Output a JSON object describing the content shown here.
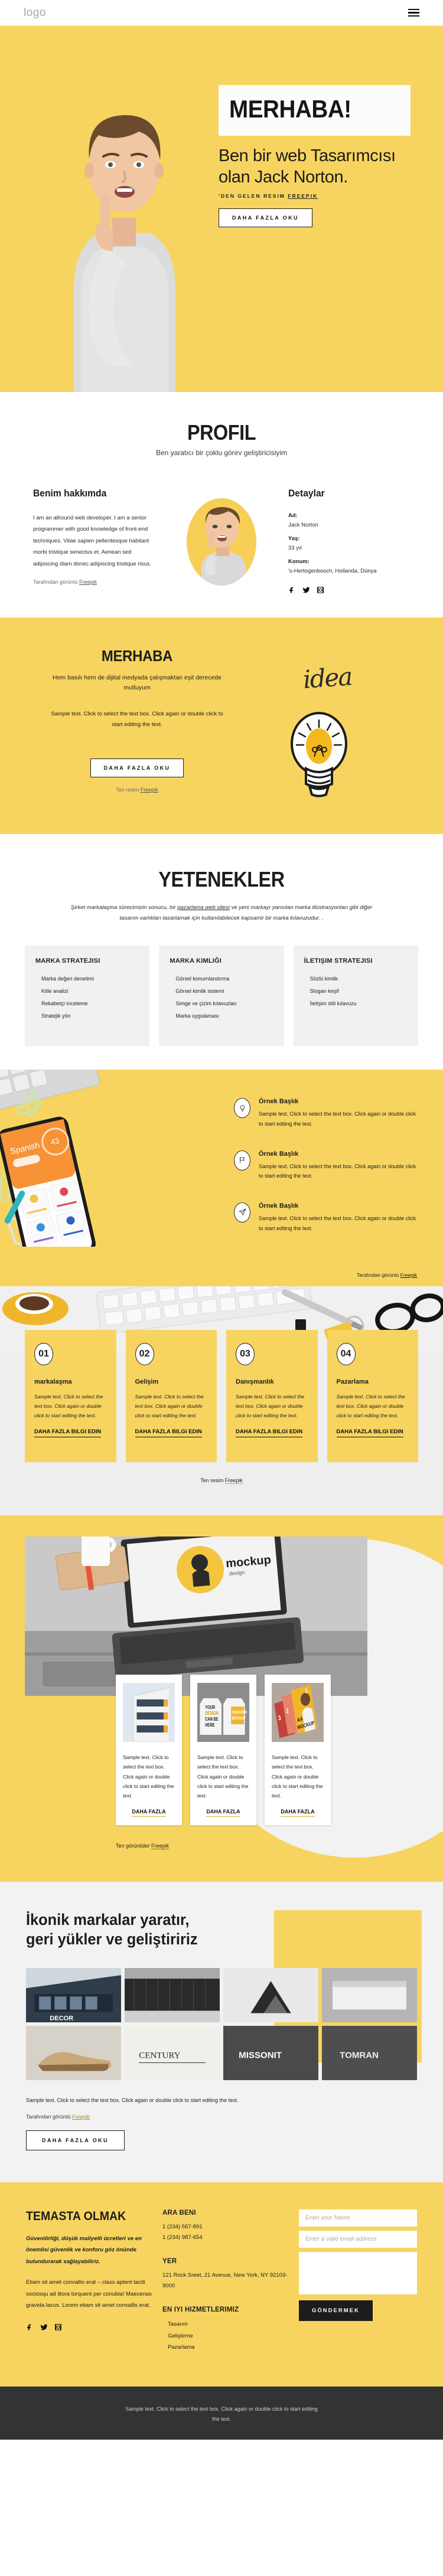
{
  "header": {
    "logo": "logo",
    "menu_label": "menu"
  },
  "hero": {
    "badge": "MERHABA!",
    "headline": "Ben bir web Tasarımcısı olan Jack Norton.",
    "credit": "'DEN GELEN RESIM ",
    "credit_link": "FREEPIK",
    "cta": "DAHA FAZLA OKU"
  },
  "profil": {
    "title": "PROFIL",
    "subtitle": "Ben yaratıcı bir çoklu görev geliştiricisiyim",
    "about_head": "Benim hakkımda",
    "about_body": "I am an allround web developer. I am a senior programmer with good knowledge of front-end techniques. Vitae sapien pellentesque habitant morbi tristique senectus et. Aenean sed adipiscing diam donec adipiscing tristique risus.",
    "about_credit": "Tarafından görüntü ",
    "about_credit_link": "Freepik",
    "details_head": "Detaylar",
    "details": [
      {
        "label": "Ad:",
        "value": "Jack Norton"
      },
      {
        "label": "Yaş:",
        "value": "33 yıl"
      },
      {
        "label": "Konum:",
        "value": "'s-Hertogenbosch, Hollanda, Dünya"
      }
    ],
    "socials": [
      "facebook-icon",
      "twitter-icon",
      "instagram-icon"
    ]
  },
  "merhaba": {
    "title": "MERHABA",
    "tagline": "Hem basılı hem de dijital medyada çalışmaktan eşit derecede mutluyum",
    "body": "Sample text. Click to select the text box. Click again or double click to start editing the text.",
    "cta": "DAHA FAZLA OKU",
    "idea_word": "idea",
    "credit": "Ten resim ",
    "credit_link": "Freepik"
  },
  "yetenekler": {
    "title": "YETENEKLER",
    "desc_1": "Şirket markalaşma sürecimizin sonucu, bir ",
    "desc_link": "pazarlama web sitesi",
    "desc_2": " ve yeni markayı yansıtan marka illüstrasyonları gibi diğer tasarım varlıkları tasarlamak için kullanılabilecek kapsamlı bir marka kılavuzudur. .",
    "cards": [
      {
        "title": "MARKA STRATEJISI",
        "items": [
          "Marka değeri denetimi",
          "Kitle analizi",
          "Rekabetçi inceleme",
          "Stratejik yön"
        ]
      },
      {
        "title": "MARKA KIMLIĞI",
        "items": [
          "Görsel konumlandırma",
          "Görsel kimlik sistemi",
          "Simge ve çizim kılavuzları",
          "Marka uygulaması"
        ]
      },
      {
        "title": "İLETIŞIM STRATEJISI",
        "items": [
          "Sözlü kimlik",
          "Slogan keşif",
          "İletişim stili kılavuzu"
        ]
      }
    ]
  },
  "features": {
    "items": [
      {
        "icon": "lightbulb-icon",
        "title": "Örnek Başlık",
        "body": "Sample text. Click to select the text box. Click again or double click to start editing the text."
      },
      {
        "icon": "flag-icon",
        "title": "Örnek Başlık",
        "body": "Sample text. Click to select the text box. Click again or double click to start editing the text."
      },
      {
        "icon": "paper-plane-icon",
        "title": "Örnek Başlık",
        "body": "Sample text. Click to select the text box. Click again or double click to start editing the text."
      }
    ],
    "credit": "Tarafından görüntü ",
    "credit_link": "Freepik"
  },
  "steps": {
    "cards": [
      {
        "num": "01",
        "title": "markalaşma",
        "body": "Sample text. Click to select the text box. Click again or double click to start editing the text.",
        "cta": "DAHA FAZLA BILGI EDIN"
      },
      {
        "num": "02",
        "title": "Gelişim",
        "body": "Sample text. Click to select the text box. Click again or double click to start editing the text.",
        "cta": "DAHA FAZLA BILGI EDIN"
      },
      {
        "num": "03",
        "title": "Danışmanlık",
        "body": "Sample text. Click to select the text box. Click again or double click to start editing the text.",
        "cta": "DAHA FAZLA BILGI EDIN"
      },
      {
        "num": "04",
        "title": "Pazarlama",
        "body": "Sample text. Click to select the text box. Click again or double click to start editing the text.",
        "cta": "DAHA FAZLA BILGI EDIN"
      }
    ],
    "credit": "Ten resim ",
    "credit_link": "Freepik"
  },
  "portfolio": {
    "cards": [
      {
        "body": "Sample text. Click to select the text box. Click again or double click to start editing the text.",
        "cta": "DAHA FAZLA"
      },
      {
        "body": "Sample text. Click to select the text box. Click again or double click to start editing the text.",
        "cta": "DAHA FAZLA"
      },
      {
        "body": "Sample text. Click to select the text box. Click again or double click to start editing the text.",
        "cta": "DAHA FAZLA"
      }
    ],
    "credit": "Ten görüntüler ",
    "credit_link": "Freepik"
  },
  "brands": {
    "headline": "İkonik markalar yaratır, geri yükler ve geliştiririz",
    "body": "Sample text. Click to select the text box. Click again or double click to start editing the text.",
    "credit": "Tarafından görüntü ",
    "credit_link": "Freepik",
    "cta": "DAHA FAZLA OKU"
  },
  "contact": {
    "title": "TEMASTA OLMAK",
    "lead": "Güvenilirliği, düşük maliyetli ücretleri ve en önemlisi güvenlik ve konforu göz önünde bulundurarak sağlayabiliriz.",
    "para": "Etiam sit amet convallis erat – class aptent taciti sociosqu ad litora torquent per conubia! Maecenas gravida lacus. Lorem etiam sit amet convallis erat.",
    "socials": [
      "facebook-icon",
      "twitter-icon",
      "instagram-icon"
    ],
    "call_head": "ARA BENI",
    "phones": "1 (234) 567-891\n1 (234) 987-654",
    "place_head": "YER",
    "address": "121 Rock Sreet, 21 Avenue, New York, NY 92103-9000",
    "services_head": "EN IYI HIZMETLERIMIZ",
    "services": [
      "Tasarım",
      "Geliştirme",
      "Pazarlama"
    ],
    "form": {
      "name_placeholder": "Enter your Name",
      "email_placeholder": "Enter a valid email address",
      "message_placeholder": "",
      "submit": "GÖNDERMEK"
    }
  },
  "footer": {
    "text": "Sample text. Click to select the text box. Click again or double click to start editing the text."
  },
  "colors": {
    "yellow": "#f7d45f",
    "dark": "#1c1c1c",
    "grey": "#f2f2f2",
    "footer": "#333333"
  }
}
